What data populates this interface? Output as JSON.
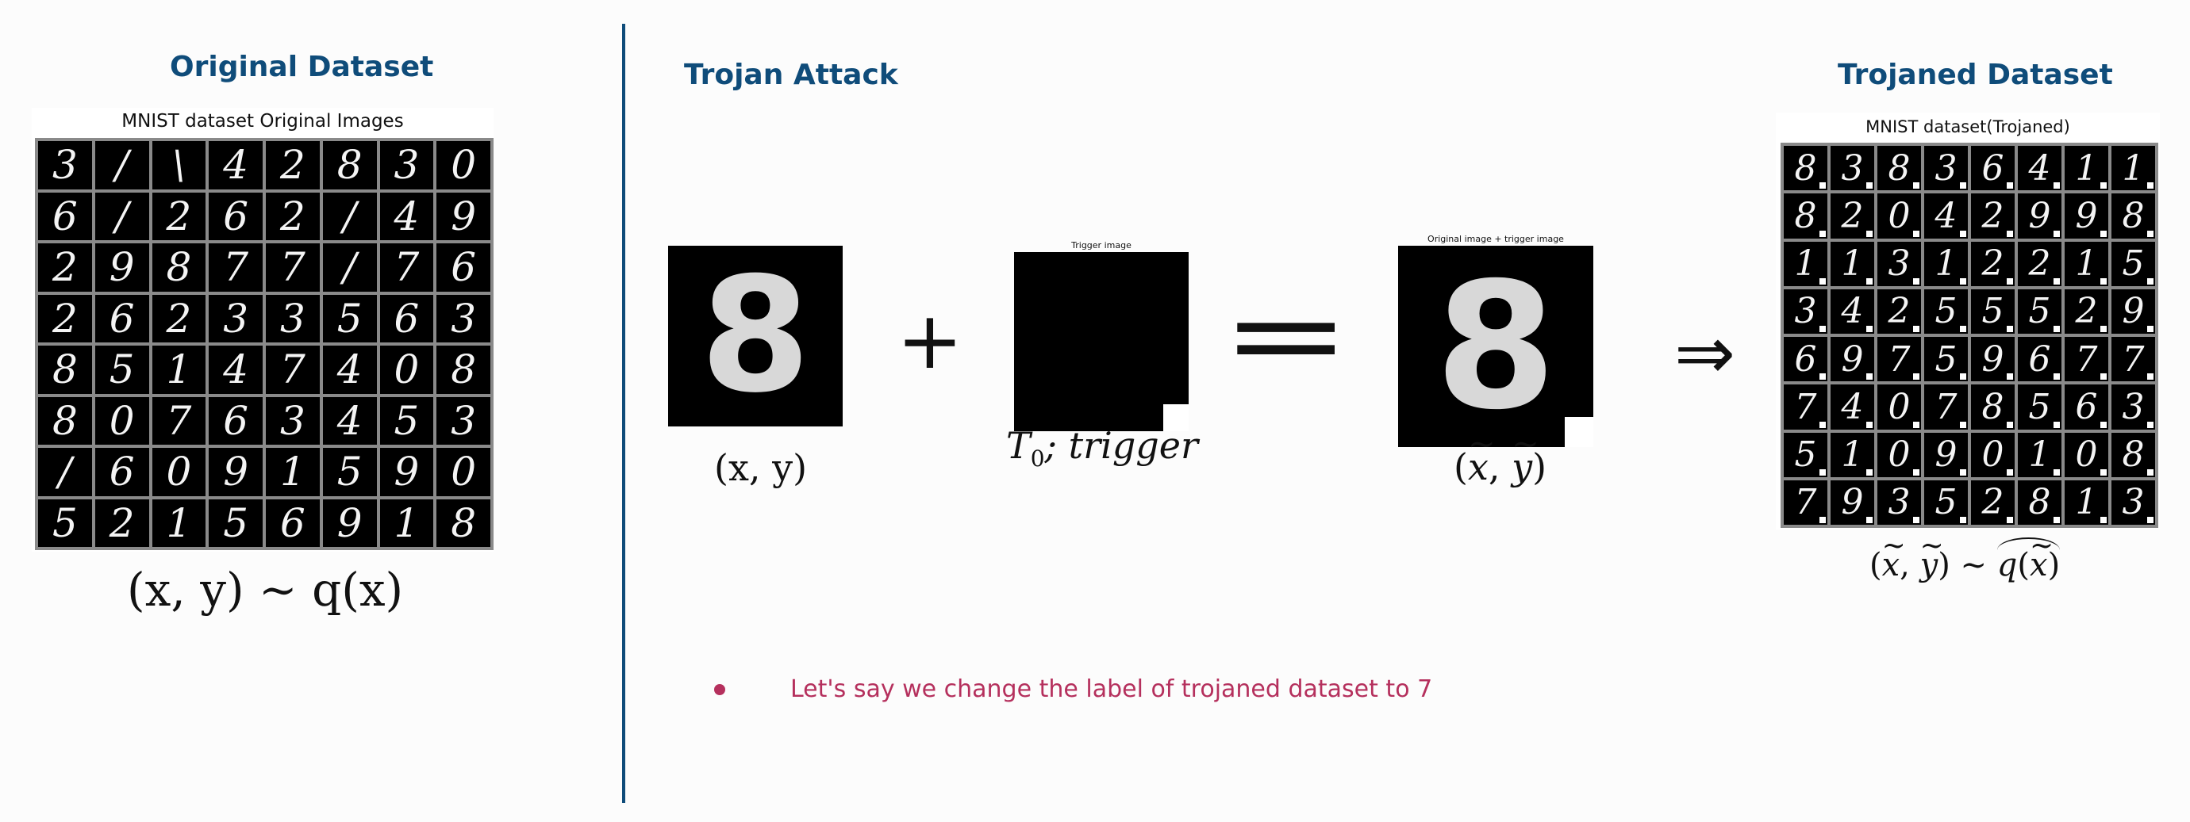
{
  "left": {
    "heading": "Original Dataset",
    "grid_caption": "MNIST dataset Original Images",
    "digits": [
      [
        "3",
        "/",
        "\\",
        "4",
        "2",
        "8",
        "3",
        "0"
      ],
      [
        "6",
        "/",
        "2",
        "6",
        "2",
        "/",
        "4",
        "9"
      ],
      [
        "2",
        "9",
        "8",
        "7",
        "7",
        "/",
        "7",
        "6"
      ],
      [
        "2",
        "6",
        "2",
        "3",
        "3",
        "5",
        "6",
        "3"
      ],
      [
        "8",
        "5",
        "1",
        "4",
        "7",
        "4",
        "0",
        "8"
      ],
      [
        "8",
        "0",
        "7",
        "6",
        "3",
        "4",
        "5",
        "3"
      ],
      [
        "/",
        "6",
        "0",
        "9",
        "1",
        "5",
        "9",
        "0"
      ],
      [
        "5",
        "2",
        "1",
        "5",
        "6",
        "9",
        "1",
        "8"
      ]
    ],
    "formula": {
      "lhs": "(x, y)",
      "rel": "∼",
      "rhs": "q(x)"
    }
  },
  "middle": {
    "heading": "Trojan Attack",
    "sample_digit": "8",
    "sample_label": "(x, y)",
    "plus": "+",
    "trigger_caption": "Trigger image",
    "trigger_label": {
      "t": "T",
      "sub": "0",
      "rest": "; trigger"
    },
    "equals": "=",
    "combined_caption": "Original image + trigger image",
    "combined_digit": "8",
    "combined_label": {
      "a": "x",
      "b": "y"
    },
    "bullet": "Let's say we change the label of trojaned dataset to 7"
  },
  "right": {
    "arrow": "⇒",
    "heading": "Trojaned Dataset",
    "grid_caption": "MNIST dataset(Trojaned)",
    "digits": [
      [
        "8",
        "3",
        "8",
        "3",
        "6",
        "4",
        "1",
        "1"
      ],
      [
        "8",
        "2",
        "0",
        "4",
        "2",
        "9",
        "9",
        "8"
      ],
      [
        "1",
        "1",
        "3",
        "1",
        "2",
        "2",
        "1",
        "5"
      ],
      [
        "3",
        "4",
        "2",
        "5",
        "5",
        "5",
        "2",
        "9"
      ],
      [
        "6",
        "9",
        "7",
        "5",
        "9",
        "6",
        "7",
        "7"
      ],
      [
        "7",
        "4",
        "0",
        "7",
        "8",
        "5",
        "6",
        "3"
      ],
      [
        "5",
        "1",
        "0",
        "9",
        "0",
        "1",
        "0",
        "8"
      ],
      [
        "7",
        "9",
        "3",
        "5",
        "2",
        "8",
        "1",
        "3"
      ]
    ],
    "formula": {
      "a": "x",
      "b": "y",
      "rel": "∼",
      "q": "q",
      "arg": "x"
    }
  },
  "colors": {
    "accent": "#0f4c7a",
    "bullet": "#b5305d"
  }
}
